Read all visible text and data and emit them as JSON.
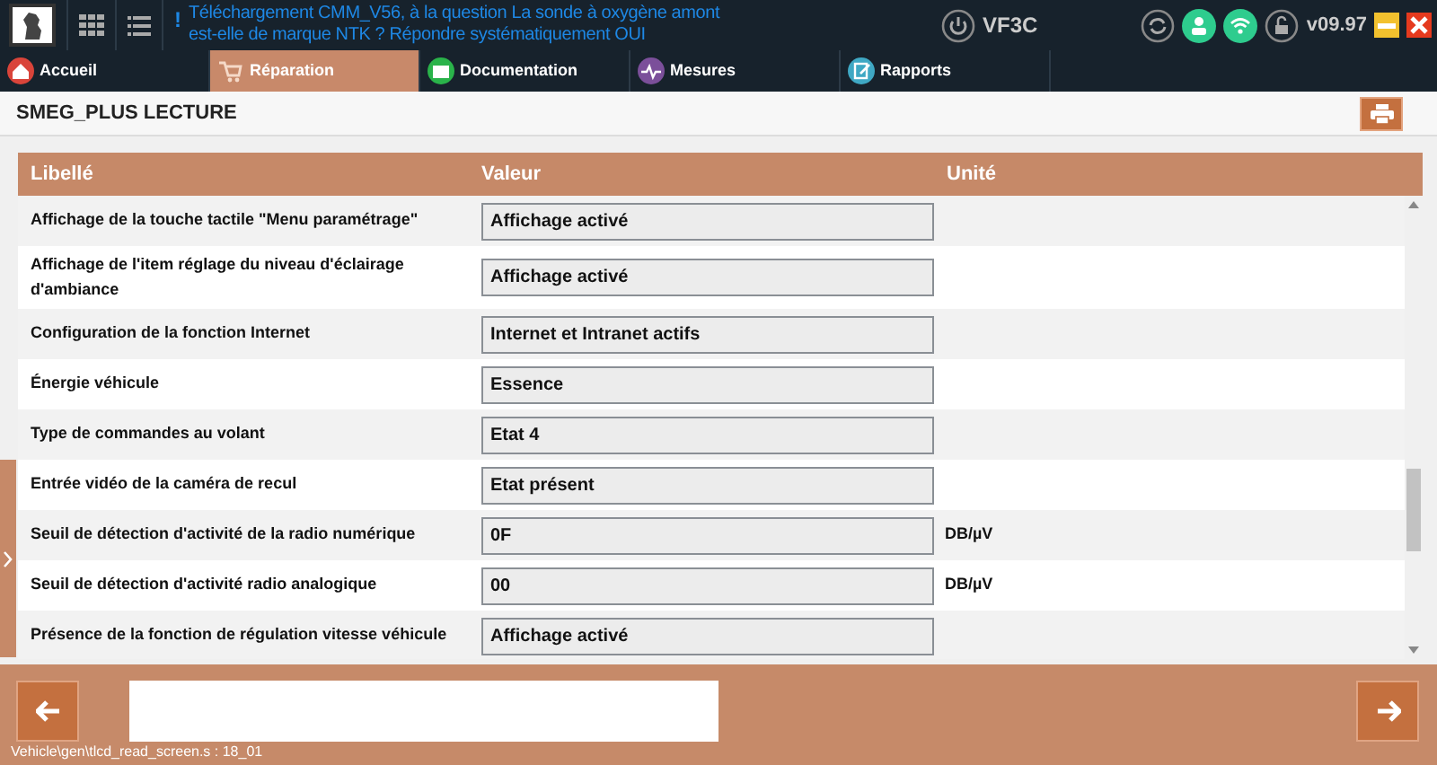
{
  "top_bar": {
    "alert_mark": "!",
    "message": "Téléchargement CMM_V56, à la question La sonde à oxygène amont est-elle de marque NTK ? Répondre systématiquement OUI",
    "vehicle": "VF3C",
    "version": "v09.97"
  },
  "tabs": [
    {
      "label": "Accueil",
      "kind": "home",
      "selected": false
    },
    {
      "label": "Réparation",
      "kind": "cart",
      "selected": true
    },
    {
      "label": "Documentation",
      "kind": "folder",
      "selected": false
    },
    {
      "label": "Mesures",
      "kind": "wave",
      "selected": false
    },
    {
      "label": "Rapports",
      "kind": "report",
      "selected": false
    }
  ],
  "page_title": "SMEG_PLUS LECTURE",
  "table": {
    "columns": [
      "Libellé",
      "Valeur",
      "Unité"
    ],
    "rows": [
      {
        "label": "Affichage de la touche tactile \"Menu paramétrage\"",
        "value": "Affichage activé"
      },
      {
        "label": "Affichage de l'item réglage du niveau d'éclairage d'ambiance",
        "value": "Affichage activé"
      },
      {
        "label": "Configuration de la fonction Internet",
        "value": "Internet et Intranet actifs"
      },
      {
        "label": "Énergie véhicule",
        "value": "Essence"
      },
      {
        "label": "Type de commandes au volant",
        "value": "Etat 4"
      },
      {
        "label": "Entrée vidéo de la caméra de recul",
        "value": "Etat présent"
      },
      {
        "label": "Seuil de détection d'activité de la radio numérique",
        "value": "0F",
        "unit": "DB/µV"
      },
      {
        "label": "Seuil de détection d'activité radio analogique",
        "value": "00",
        "unit": "DB/µV"
      },
      {
        "label": "Présence de la fonction de régulation vitesse véhicule",
        "value": "Affichage activé"
      }
    ]
  },
  "status_bar": "Vehicle\\gen\\tlcd_read_screen.s : 18_01"
}
